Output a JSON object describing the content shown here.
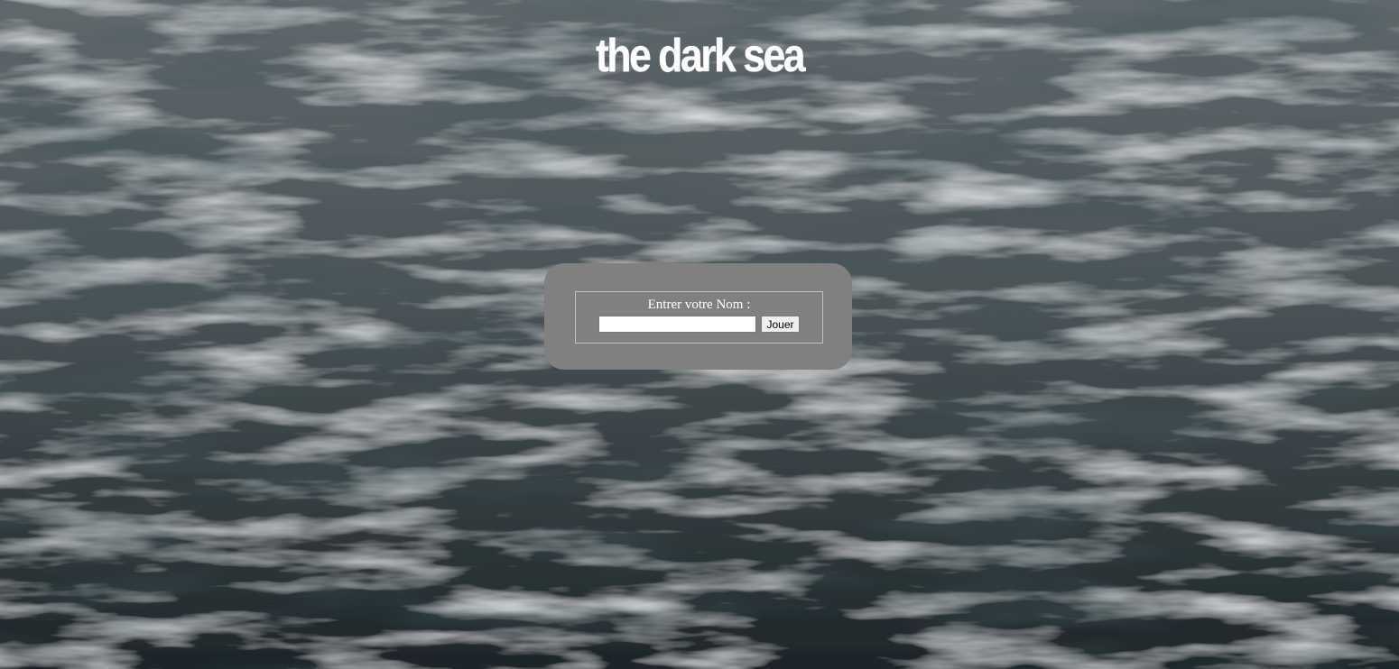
{
  "page": {
    "title": "the dark sea",
    "background_colors": [
      "#5f686c",
      "#3b4448",
      "#1d2629"
    ]
  },
  "login": {
    "label": "Entrer votre Nom :",
    "name_value": "",
    "name_placeholder": "",
    "play_button_label": "Jouer",
    "panel_color": "#808080"
  }
}
